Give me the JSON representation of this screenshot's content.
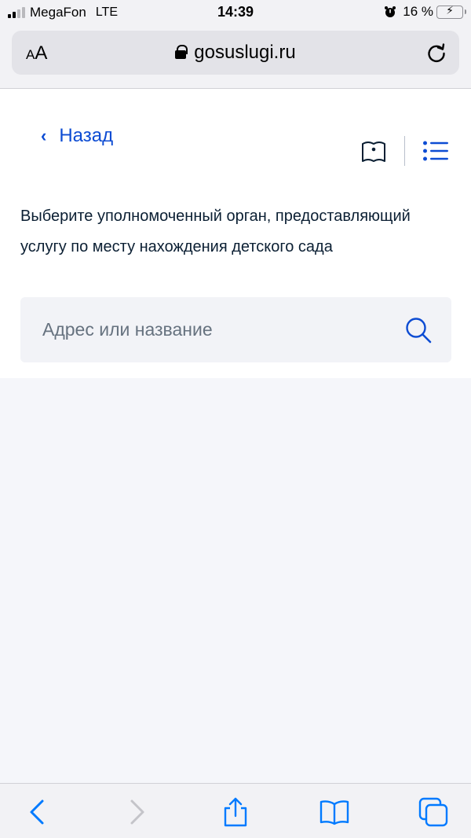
{
  "status_bar": {
    "carrier": "MegaFon",
    "network": "LTE",
    "time": "14:39",
    "battery": "16 %",
    "battery_level": 0.16
  },
  "browser": {
    "text_size_label": "AA",
    "url": "gosuslugi.ru"
  },
  "page": {
    "back_label": "Назад",
    "prompt": "Выберите уполномоченный орган, предоставляющий услугу по месту нахождения детского сада",
    "search": {
      "placeholder": "Адрес или название",
      "value": ""
    }
  },
  "icons": {
    "map": "map-icon",
    "menu": "list-menu-icon",
    "search": "search-icon",
    "reload": "reload-icon",
    "lock": "lock-icon"
  },
  "colors": {
    "accent": "#0d4cd3",
    "text": "#0b1f33",
    "page_background": "#f5f6fa",
    "input_background": "#f2f3f7",
    "ios_blue": "#007aff"
  }
}
